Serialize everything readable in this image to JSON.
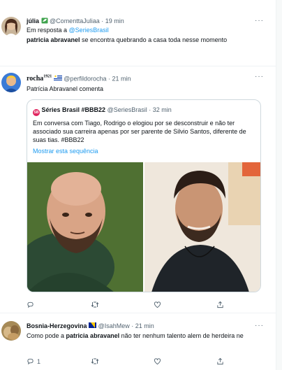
{
  "tweet1": {
    "display_name": "júlia",
    "handle": "@ComenttaJuliaa",
    "sep": "·",
    "time": "19 min",
    "reply_prefix": "Em resposta a",
    "reply_handle": "@SeriesBrasil",
    "bold_text": "patricia abravanel",
    "text": " se encontra quebrando a casa toda nesse momento"
  },
  "tweet2": {
    "display_name": "rocha",
    "name_superscript": "1921",
    "handle": "@perfildorocha",
    "sep": "·",
    "time": "21 min",
    "text": "Patrícia Abravanel comenta",
    "quote": {
      "badge_text": "SB",
      "display_name": "Séries Brasil #BBB22",
      "handle": "@SeriesBrasil",
      "sep": "·",
      "time": "32 min",
      "text": "Em conversa com Tiago, Rodrigo o elogiou por se desconstruir e não ter associado sua carreira apenas por ser parente de Silvio Santos, diferente de suas tias. #BBB22",
      "show_thread": "Mostrar esta sequência"
    }
  },
  "tweet3": {
    "display_name": "Bosnia-Herzegovina",
    "handle": "@IsahMew",
    "sep": "·",
    "time": "21 min",
    "text_prefix": "Como pode a ",
    "bold_text": "patricia abravanel",
    "text_suffix": " não ter nenhum talento alem de herdeira ne",
    "reply_count": "1"
  },
  "more_label": "···",
  "colors": {
    "accent": "#1d9bf0",
    "muted": "#536471",
    "border": "#eff3f4"
  },
  "icons": [
    "reply-icon",
    "retweet-icon",
    "like-icon",
    "share-icon",
    "verified-flag-icon",
    "more-icon"
  ]
}
